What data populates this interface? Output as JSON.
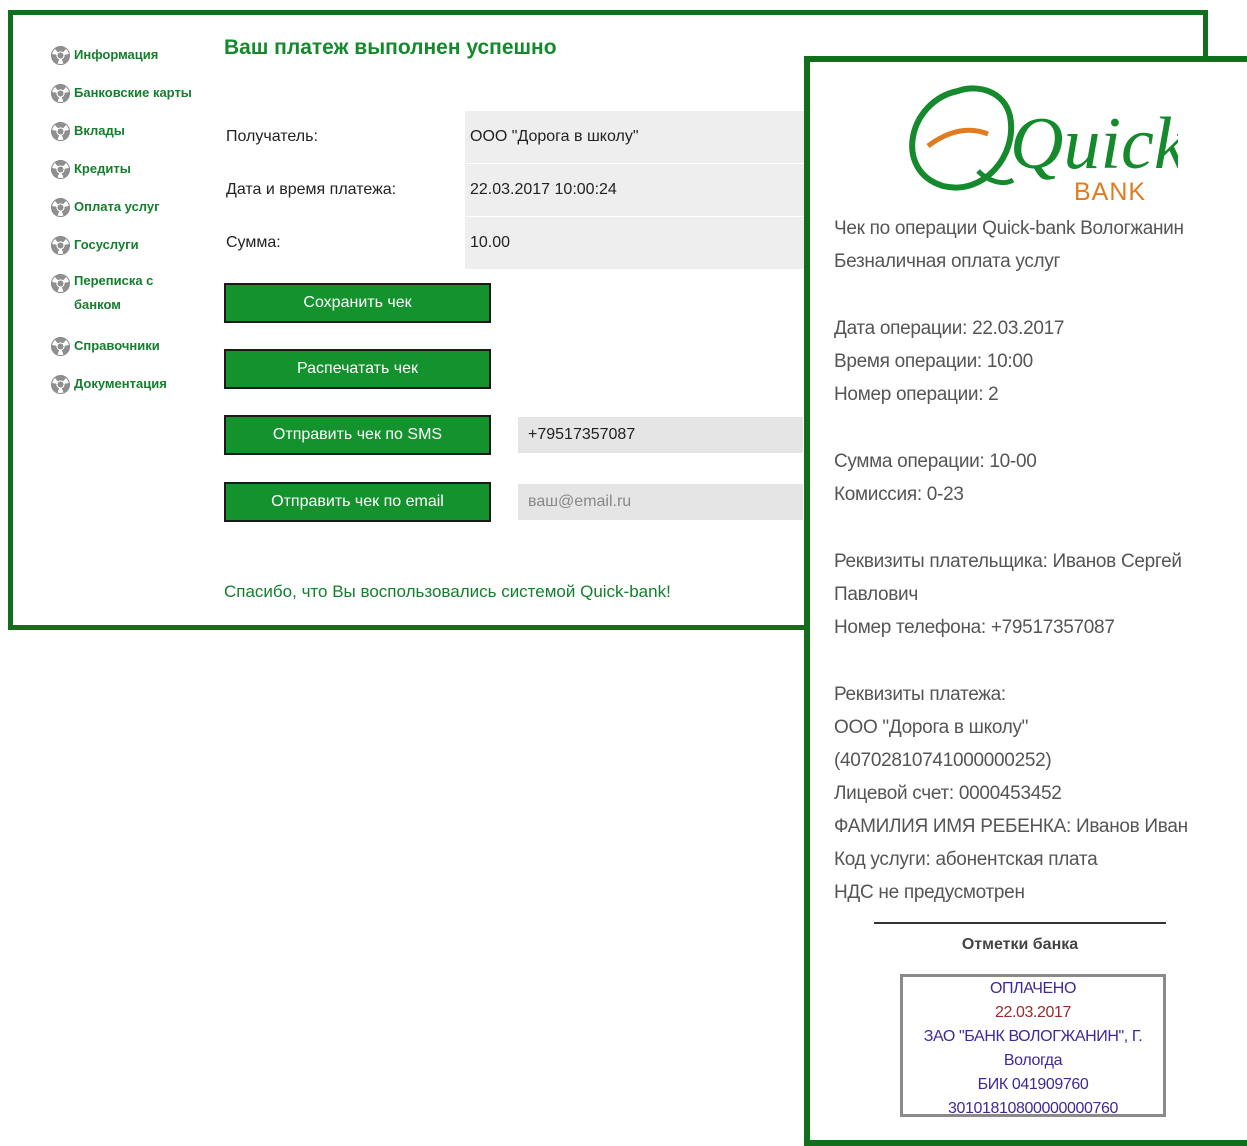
{
  "sidebar": {
    "items": [
      {
        "label": "Информация"
      },
      {
        "label": "Банковские карты"
      },
      {
        "label": "Вклады"
      },
      {
        "label": "Кредиты"
      },
      {
        "label": "Оплата услуг"
      },
      {
        "label": "Госуслуги"
      },
      {
        "label": "Переписка с банком"
      },
      {
        "label": "Справочники"
      },
      {
        "label": "Документация"
      }
    ]
  },
  "main": {
    "title": "Ваш платеж выполнен успешно",
    "rows": [
      {
        "label": "Получатель:",
        "value": "ООО \"Дорога в школу\""
      },
      {
        "label": "Дата и время платежа:",
        "value": "22.03.2017 10:00:24"
      },
      {
        "label": "Сумма:",
        "value": "10.00"
      }
    ],
    "buttons": {
      "save": "Сохранить чек",
      "print": "Распечатать чек",
      "sms": "Отправить чек по SMS",
      "email": "Отправить чек по email"
    },
    "sms_value": "+79517357087",
    "email_placeholder": "ваш@email.ru",
    "thanks": "Спасибо, что Вы воспользовались системой Quick-bank!"
  },
  "receipt": {
    "logo_text": "Quick",
    "logo_sub": "BANK",
    "lines": [
      "Чек по операции Quick-bank Вологжанин",
      "Безналичная оплата услуг",
      "",
      "Дата операции: 22.03.2017",
      "Время операции: 10:00",
      "Номер операции: 2",
      "",
      "Сумма операции: 10-00",
      "Комиссия: 0-23",
      "",
      "Реквизиты плательщика: Иванов Сергей",
      "Павлович",
      "Номер телефона: +79517357087",
      "",
      "Реквизиты платежа:",
      "ООО \"Дорога в школу\"",
      "(40702810741000000252)",
      "Лицевой счет: 0000453452",
      "ФАМИЛИЯ ИМЯ РЕБЕНКА: Иванов Иван",
      "Код услуги: абонентская плата",
      "НДС не предусмотрен"
    ],
    "marks_title": "Отметки банка",
    "stamp": {
      "status": "ОПЛАЧЕНО",
      "date": "22.03.2017",
      "bank": "ЗАО \"БАНК ВОЛОГЖАНИН\", Г.",
      "city": "Вологда",
      "bik": "БИК 041909760",
      "account": "30101810800000000760"
    }
  },
  "colors": {
    "brand_green": "#148a2c",
    "border_green": "#136e1b",
    "logo_orange": "#e07b20"
  }
}
